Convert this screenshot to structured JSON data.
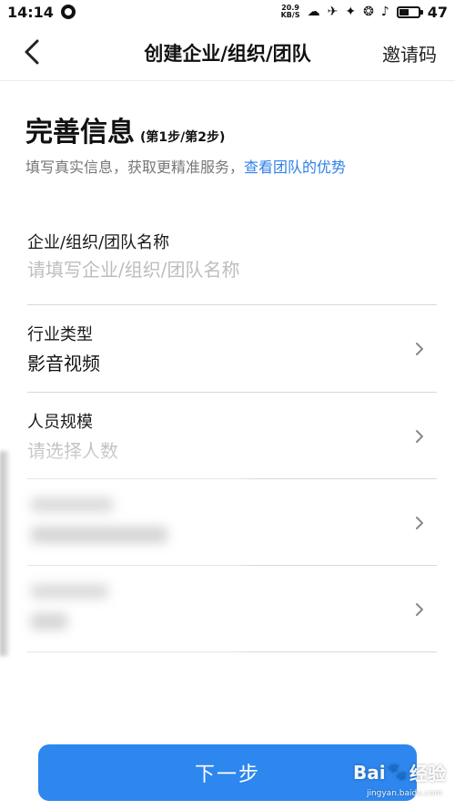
{
  "status_bar": {
    "time": "14:14",
    "net_speed_value": "20.9",
    "net_speed_unit": "KB/S",
    "battery": "47",
    "battery_level": 0.47
  },
  "nav": {
    "title": "创建企业/组织/团队",
    "action": "邀请码"
  },
  "heading": {
    "title": "完善信息",
    "step": "(第1步/第2步)"
  },
  "subtitle": {
    "text": "填写真实信息，获取更精准服务，",
    "link": "查看团队的优势"
  },
  "form": {
    "org_name": {
      "label": "企业/组织/团队名称",
      "placeholder": "请填写企业/组织/团队名称"
    },
    "industry": {
      "label": "行业类型",
      "value": "影音视频"
    },
    "staff_size": {
      "label": "人员规模",
      "placeholder": "请选择人数"
    }
  },
  "next_button": {
    "label": "下一步"
  },
  "watermark": {
    "brand": "Bai",
    "brand_suffix": "经验",
    "url": "jingyan.baidu.com"
  },
  "colors": {
    "accent": "#2d87ee",
    "link": "#2f80e8",
    "placeholder": "#bdbdbd"
  }
}
